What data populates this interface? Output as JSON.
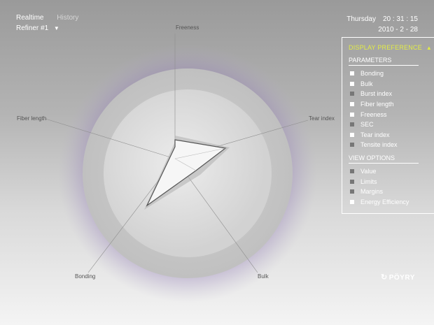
{
  "tabs": {
    "realtime": "Realtime",
    "history": "History"
  },
  "refiner": {
    "label": "Refiner #1",
    "caret": "▼"
  },
  "clock": {
    "day": "Thursday",
    "time": "20 : 31 : 15",
    "date": "2010 - 2 - 28"
  },
  "radar": {
    "axes": [
      "Freeness",
      "Tear index",
      "Bulk",
      "Bonding",
      "Fiber length"
    ],
    "colors": {
      "outer_disc": "#c4c4c4",
      "inner_disc": "#dadada",
      "glow": "#8e76b2",
      "polygon_fill": "#ffffff",
      "polygon_stroke": "#555555"
    }
  },
  "panel": {
    "title": "DISPLAY PREFERENCE",
    "title_icon": "▲",
    "accent": "#e2ec45",
    "parameters_heading": "PARAMETERS",
    "parameters": [
      {
        "label": "Bonding",
        "checked": true
      },
      {
        "label": "Bulk",
        "checked": true
      },
      {
        "label": "Burst index",
        "checked": false
      },
      {
        "label": "Fiber length",
        "checked": true
      },
      {
        "label": "Freeness",
        "checked": true
      },
      {
        "label": "SEC",
        "checked": false
      },
      {
        "label": "Tear index",
        "checked": true
      },
      {
        "label": "Tensite index",
        "checked": false
      }
    ],
    "view_heading": "VIEW OPTIONS",
    "view_options": [
      {
        "label": "Value",
        "checked": false
      },
      {
        "label": "Limits",
        "checked": false
      },
      {
        "label": "Margins",
        "checked": false
      },
      {
        "label": "Energy Efficiency",
        "checked": true
      }
    ]
  },
  "brand": {
    "name": "PÖYRY",
    "icon": "brand-swirl-icon"
  }
}
